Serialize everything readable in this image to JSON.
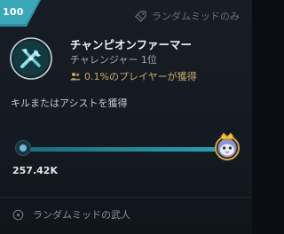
{
  "card": {
    "score": "100",
    "mode_tag": "ランダムミッドのみ",
    "title": "チャンピオンファーマー",
    "rank": "チャレンジャー 1位",
    "players": "0.1%のプレイヤーが獲得",
    "description": "キルまたはアシストを獲得",
    "progress_value": "257.42K",
    "progress_fraction": 1.0,
    "footer": "ランダムミッドの武人"
  },
  "colors": {
    "ribbon": "#3aa8b8",
    "accent_gold": "#c9a96b",
    "progress_fill": "#2aa0b3"
  },
  "icons": {
    "mode": "tag-icon",
    "emblem": "crossed-tools-emblem-icon",
    "players": "people-icon",
    "goal": "crowned-poro-icon",
    "footer": "target-icon"
  }
}
